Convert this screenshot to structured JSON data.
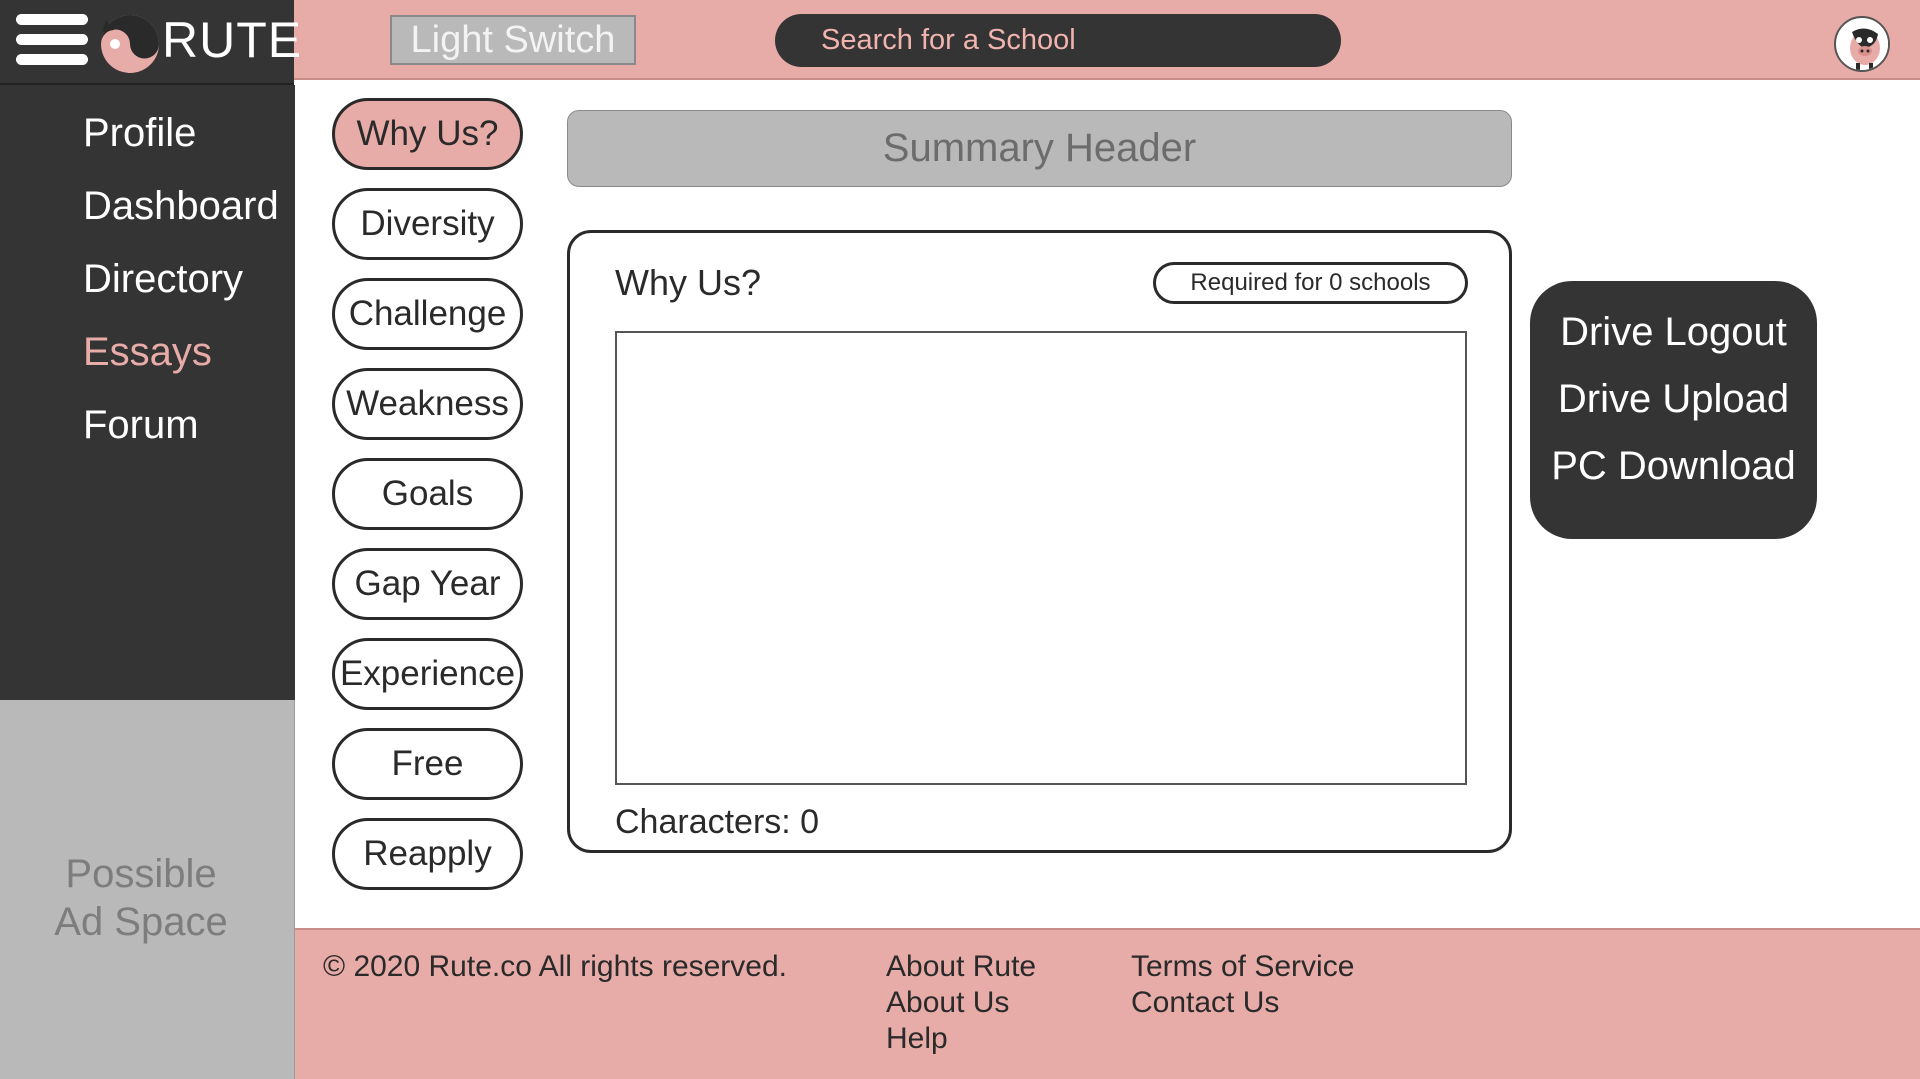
{
  "header": {
    "brand_name": "RUTE",
    "menu_icon": "hamburger-menu-icon",
    "logo_icon": "pig-yin-yang-logo-icon",
    "light_switch_label": "Light Switch",
    "search_placeholder": "Search for a School",
    "avatar_icon": "pig-avatar-icon"
  },
  "sidebar": {
    "items": [
      {
        "label": "Profile",
        "active": false
      },
      {
        "label": "Dashboard",
        "active": false
      },
      {
        "label": "Directory",
        "active": false
      },
      {
        "label": "Essays",
        "active": true
      },
      {
        "label": "Forum",
        "active": false
      }
    ],
    "ad_line1": "Possible",
    "ad_line2": "Ad Space"
  },
  "essay_topics": [
    {
      "label": "Why Us?",
      "active": true
    },
    {
      "label": "Diversity",
      "active": false
    },
    {
      "label": "Challenge",
      "active": false
    },
    {
      "label": "Weakness",
      "active": false
    },
    {
      "label": "Goals",
      "active": false
    },
    {
      "label": "Gap Year",
      "active": false
    },
    {
      "label": "Experience",
      "active": false
    },
    {
      "label": "Free",
      "active": false
    },
    {
      "label": "Reapply",
      "active": false
    }
  ],
  "main": {
    "summary_header": "Summary Header",
    "essay_title": "Why Us?",
    "required_badge": "Required for 0 schools",
    "essay_value": "",
    "char_count": "Characters: 0"
  },
  "drive_panel": {
    "logout": "Drive Logout",
    "upload": "Drive Upload",
    "download": "PC Download"
  },
  "footer": {
    "copyright": "© 2020 Rute.co All rights reserved.",
    "about_rute": "About Rute",
    "about_us": "About Us",
    "help": "Help",
    "terms": "Terms of Service",
    "contact": "Contact Us"
  },
  "colors": {
    "pink_accent": "#e8aca8",
    "dark_panel": "#343434",
    "gray_panel": "#b9b9b9"
  }
}
